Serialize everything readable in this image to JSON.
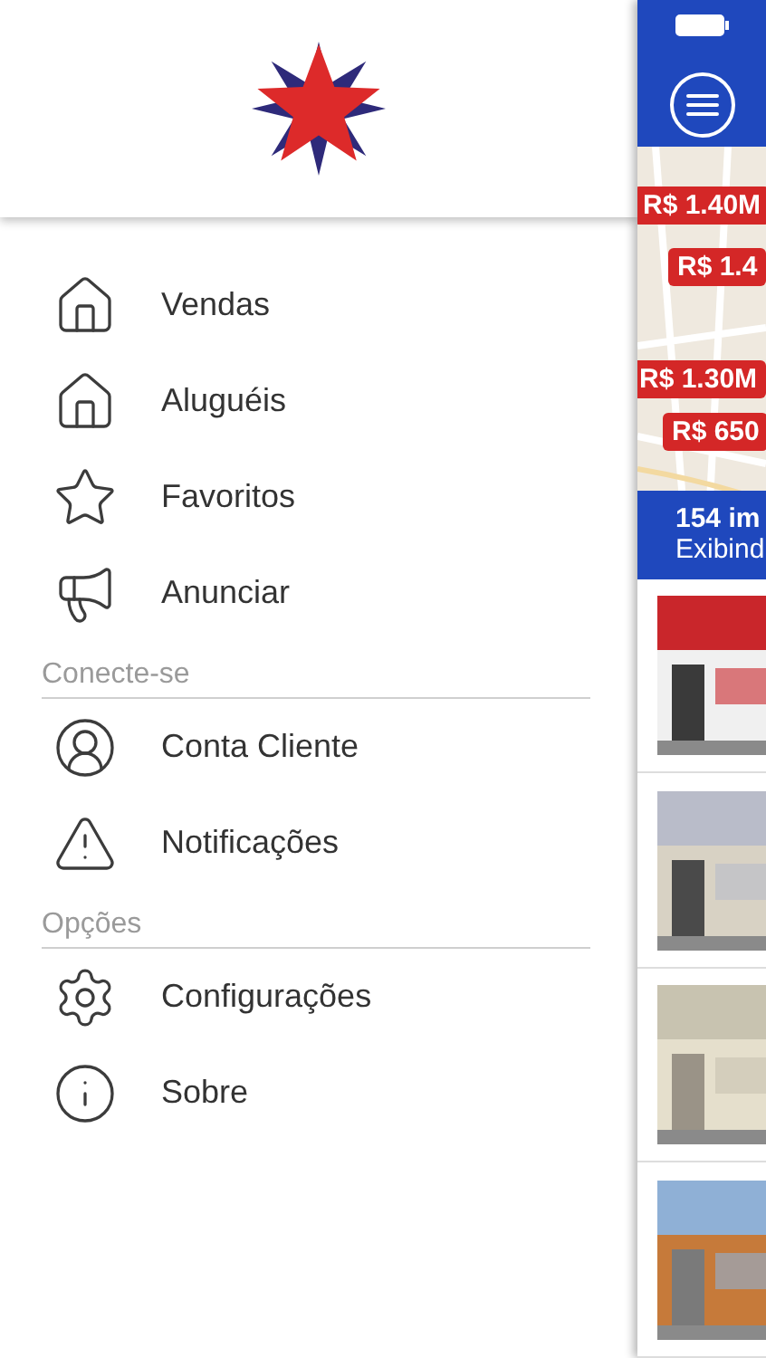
{
  "menu": {
    "sections": [
      {
        "items": [
          {
            "label": "Vendas"
          },
          {
            "label": "Aluguéis"
          },
          {
            "label": "Favoritos"
          },
          {
            "label": "Anunciar"
          }
        ]
      },
      {
        "title": "Conecte-se",
        "items": [
          {
            "label": "Conta Cliente"
          },
          {
            "label": "Notificações"
          }
        ]
      },
      {
        "title": "Opções",
        "items": [
          {
            "label": "Configurações"
          },
          {
            "label": "Sobre"
          }
        ]
      }
    ]
  },
  "listing_panel": {
    "price_tags": [
      {
        "label": "R$ 1.40M"
      },
      {
        "label": "R$ 1.4"
      },
      {
        "label": "R$ 1.30M"
      },
      {
        "label": "R$ 650"
      }
    ],
    "summary": {
      "count": "154 im",
      "subtitle": "Exibind"
    }
  }
}
